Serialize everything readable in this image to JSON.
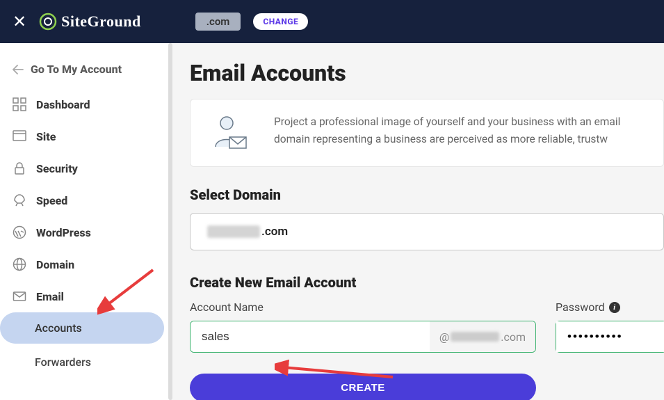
{
  "header": {
    "logo_text": "SiteGround",
    "domain_suffix": ".com",
    "change_label": "CHANGE"
  },
  "sidebar": {
    "back_label": "Go To My Account",
    "items": [
      {
        "label": "Dashboard"
      },
      {
        "label": "Site"
      },
      {
        "label": "Security"
      },
      {
        "label": "Speed"
      },
      {
        "label": "WordPress"
      },
      {
        "label": "Domain"
      },
      {
        "label": "Email"
      }
    ],
    "sub_items": [
      {
        "label": "Accounts",
        "active": true
      },
      {
        "label": "Forwarders",
        "active": false
      }
    ]
  },
  "main": {
    "title": "Email Accounts",
    "info_text": "Project a professional image of yourself and your business with an email domain representing a business are perceived as more reliable, trustw",
    "select_domain_title": "Select Domain",
    "selected_domain_tld": ".com",
    "create_title": "Create New Email Account",
    "account_name_label": "Account Name",
    "account_name_value": "sales",
    "account_suffix_tld": ".com",
    "at_sign": "@",
    "password_label": "Password",
    "password_value": "••••••••••",
    "create_button": "CREATE"
  }
}
